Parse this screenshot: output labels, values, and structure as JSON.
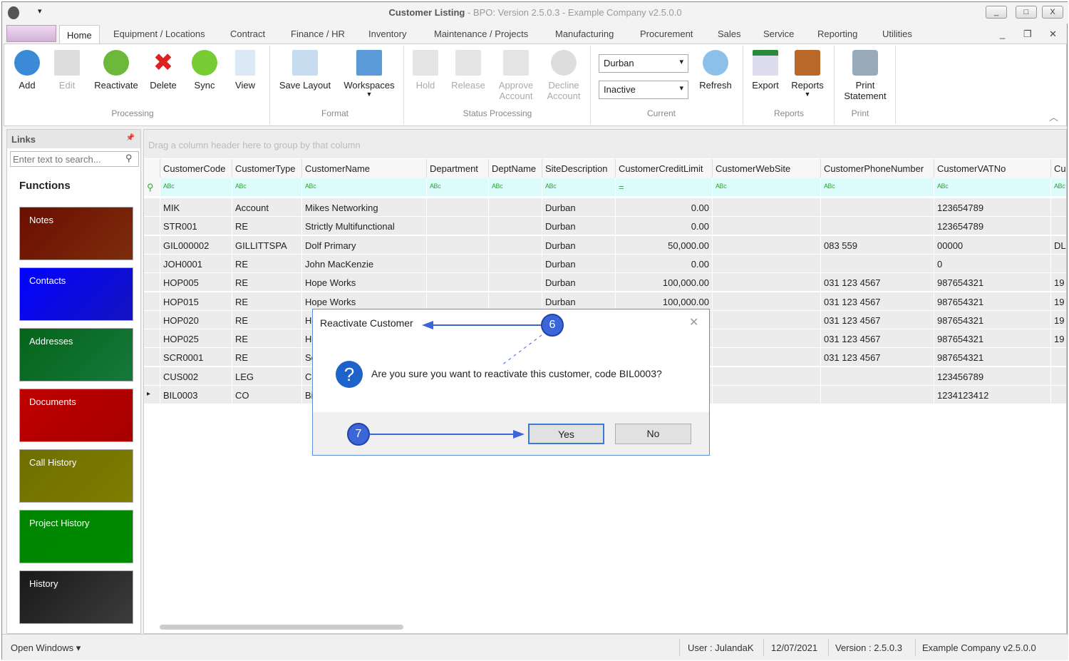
{
  "window": {
    "title_main": "Customer Listing",
    "title_rest": " - BPO: Version 2.5.0.3 - Example Company v2.5.0.0",
    "min": "_",
    "max": "□",
    "close": "X"
  },
  "tabs": [
    "Home",
    "Equipment / Locations",
    "Contract",
    "Finance / HR",
    "Inventory",
    "Maintenance / Projects",
    "Manufacturing",
    "Procurement",
    "Sales",
    "Service",
    "Reporting",
    "Utilities"
  ],
  "ribbon": {
    "buttons": [
      "Add",
      "Edit",
      "Reactivate",
      "Delete",
      "Sync",
      "View",
      "Save Layout",
      "Workspaces",
      "Hold",
      "Release",
      "Approve Account",
      "Decline Account",
      "Refresh",
      "Export",
      "Reports",
      "Print Statement"
    ],
    "groups": [
      "Processing",
      "Format",
      "Status Processing",
      "Current",
      "Reports",
      "Print"
    ],
    "site_select": "Durban",
    "status_select": "Inactive"
  },
  "links": {
    "title": "Links",
    "search_placeholder": "Enter text to search...",
    "functions": "Functions",
    "tiles": [
      {
        "label": "Notes",
        "color": "#a63c10"
      },
      {
        "label": "Contacts",
        "color": "#1a1aff"
      },
      {
        "label": "Addresses",
        "color": "#1fa050"
      },
      {
        "label": "Documents",
        "color": "#dd0000"
      },
      {
        "label": "Call History",
        "color": "#a8a800"
      },
      {
        "label": "Project History",
        "color": "#00b800"
      },
      {
        "label": "History",
        "color": "#505050"
      }
    ]
  },
  "grid": {
    "group_hint": "Drag a column header here to group by that column",
    "columns": [
      "CustomerCode",
      "CustomerType",
      "CustomerName",
      "Department",
      "DeptName",
      "SiteDescription",
      "CustomerCreditLimit",
      "CustomerWebSite",
      "CustomerPhoneNumber",
      "CustomerVATNo",
      "Cus"
    ],
    "rows": [
      [
        "MIK",
        "Account",
        "Mikes Networking",
        "",
        "",
        "Durban",
        "0.00",
        "",
        "",
        "123654789",
        ""
      ],
      [
        "STR001",
        "RE",
        "Strictly Multifunctional",
        "",
        "",
        "Durban",
        "0.00",
        "",
        "",
        "123654789",
        ""
      ],
      [
        "GIL000002",
        "GILLITTSPA",
        "Dolf Primary",
        "",
        "",
        "Durban",
        "50,000.00",
        "",
        "083 559",
        "00000",
        "DL"
      ],
      [
        "JOH0001",
        "RE",
        "John MacKenzie",
        "",
        "",
        "Durban",
        "0.00",
        "",
        "",
        "0",
        ""
      ],
      [
        "HOP005",
        "RE",
        "Hope Works",
        "",
        "",
        "Durban",
        "100,000.00",
        "",
        "031 123 4567",
        "987654321",
        "19"
      ],
      [
        "HOP015",
        "RE",
        "Hope Works",
        "",
        "",
        "Durban",
        "100,000.00",
        "",
        "031 123 4567",
        "987654321",
        "19"
      ],
      [
        "HOP020",
        "RE",
        "Ho",
        "",
        "",
        "",
        "",
        "",
        "031 123 4567",
        "987654321",
        "19"
      ],
      [
        "HOP025",
        "RE",
        "Ho",
        "",
        "",
        "",
        "",
        "",
        "031 123 4567",
        "987654321",
        "19"
      ],
      [
        "SCR0001",
        "RE",
        "Sc",
        "",
        "",
        "",
        "",
        "",
        "031 123 4567",
        "987654321",
        ""
      ],
      [
        "CUS002",
        "LEG",
        "Cu",
        "",
        "",
        "",
        "",
        "",
        "",
        "123456789",
        ""
      ],
      [
        "BIL0003",
        "CO",
        "Bil",
        "",
        "",
        "",
        "",
        "",
        "",
        "1234123412",
        ""
      ]
    ]
  },
  "dialog": {
    "title": "Reactivate Customer",
    "message": "Are you sure you want to reactivate this customer, code BIL0003?",
    "yes": "Yes",
    "no": "No",
    "step6": "6",
    "step7": "7"
  },
  "status": {
    "open_windows": "Open Windows ▾",
    "user": "User : JulandaK",
    "date": "12/07/2021",
    "version": "Version : 2.5.0.3",
    "company": "Example Company v2.5.0.0"
  }
}
